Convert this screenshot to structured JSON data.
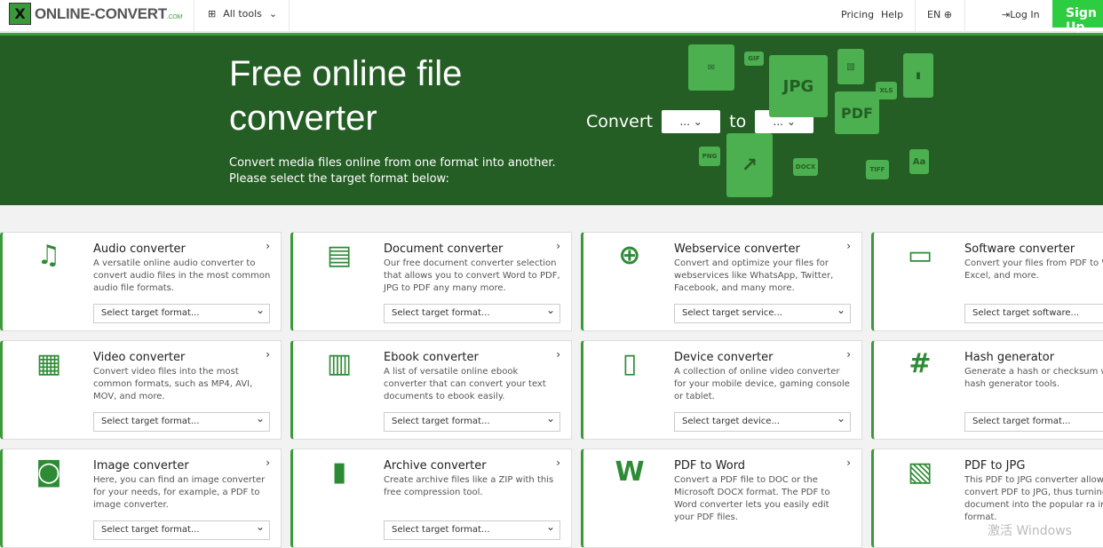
{
  "header": {
    "logo": "ONLINE-CONVERT",
    "logo_suffix": ".COM",
    "all_tools": "All tools",
    "pricing": "Pricing",
    "help": "Help",
    "lang": "EN",
    "login": "Log In",
    "signup": "Sign Up"
  },
  "hero": {
    "title": "Free online file converter",
    "subtitle": "Convert media files online from one format into another. Please select the target format below:",
    "convert_label": "Convert",
    "to_label": "to",
    "from_value": "...",
    "to_value": "...",
    "file_icons": [
      "GIF",
      "JPG",
      "XLS",
      "PDF",
      "PNG",
      "DOCX",
      "TIFF",
      "Aa"
    ]
  },
  "cards": [
    {
      "title": "Audio converter",
      "desc": "A versatile online audio converter to convert audio files in the most common audio file formats.",
      "select": "Select target format...",
      "icon": "music-icon",
      "glyph": "♫"
    },
    {
      "title": "Document converter",
      "desc": "Our free document converter selection that allows you to convert Word to PDF, JPG to PDF any many more.",
      "select": "Select target format...",
      "icon": "document-icon",
      "glyph": "▤"
    },
    {
      "title": "Webservice converter",
      "desc": "Convert and optimize your files for webservices like WhatsApp, Twitter, Facebook, and many more.",
      "select": "Select target service...",
      "icon": "globe-icon",
      "glyph": "⊕"
    },
    {
      "title": "Software converter",
      "desc": "Convert your files from PDF to Wo to Excel, and more.",
      "select": "Select target software...",
      "icon": "computer-icon",
      "glyph": "▭"
    },
    {
      "title": "Video converter",
      "desc": "Convert video files into the most common formats, such as MP4, AVI, MOV, and more.",
      "select": "Select target format...",
      "icon": "film-icon",
      "glyph": "▦"
    },
    {
      "title": "Ebook converter",
      "desc": "A list of versatile online ebook converter that can convert your text documents to ebook easily.",
      "select": "Select target format...",
      "icon": "books-icon",
      "glyph": "▥"
    },
    {
      "title": "Device converter",
      "desc": "A collection of online video converter for your mobile device, gaming console or tablet.",
      "select": "Select target device...",
      "icon": "tablet-icon",
      "glyph": "▯"
    },
    {
      "title": "Hash generator",
      "desc": "Generate a hash or checksum with hash generator tools.",
      "select": "Select target format...",
      "icon": "hash-icon",
      "glyph": "#"
    },
    {
      "title": "Image converter",
      "desc": "Here, you can find an image converter for your needs, for example, a PDF to image converter.",
      "select": "Select target format...",
      "icon": "camera-icon",
      "glyph": "◙"
    },
    {
      "title": "Archive converter",
      "desc": "Create archive files like a ZIP with this free compression tool.",
      "select": "Select target format...",
      "icon": "zip-icon",
      "glyph": "▮"
    },
    {
      "title": "PDF to Word",
      "desc": "Convert a PDF file to DOC or the Microsoft DOCX format. The PDF to Word converter lets you easily edit your PDF files.",
      "select": "",
      "icon": "word-file-icon",
      "glyph": "W"
    },
    {
      "title": "PDF to JPG",
      "desc": "This PDF to JPG converter allows y convert PDF to JPG, thus turning y text document into the popular ra image format.",
      "select": "",
      "icon": "image-file-icon",
      "glyph": "▧"
    }
  ],
  "watermark": "激活 Windows"
}
